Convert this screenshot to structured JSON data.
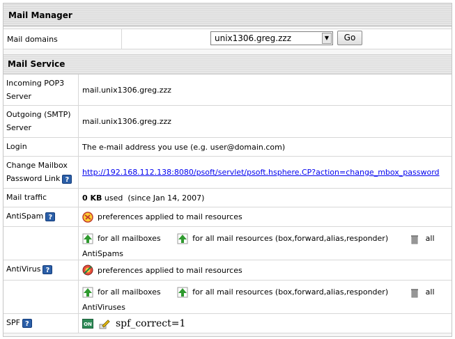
{
  "header": {
    "title": "Mail Manager"
  },
  "domains": {
    "label": "Mail domains",
    "selected": "unix1306.greg.zzz",
    "go_label": "Go"
  },
  "section": {
    "title": "Mail Service"
  },
  "rows": {
    "pop3": {
      "label": "Incoming POP3 Server",
      "value": "mail.unix1306.greg.zzz"
    },
    "smtp": {
      "label": "Outgoing (SMTP) Server",
      "value": "mail.unix1306.greg.zzz"
    },
    "login": {
      "label": "Login",
      "value": "The e-mail address you use (e.g. user@domain.com)"
    },
    "change_pw": {
      "label": "Change Mailbox Password Link",
      "url": "http://192.168.112.138:8080/psoft/servlet/psoft.hsphere.CP?action=change_mbox_password"
    },
    "traffic": {
      "label": "Mail traffic",
      "amount": "0 KB",
      "unit_text": "used",
      "since": "(since Jan 14, 2007)"
    },
    "antispam": {
      "label": "AntiSpam",
      "pref_text": "preferences applied to mail resources",
      "all_mailboxes": "for all mailboxes",
      "all_resources": "for all mail resources (box,forward,alias,responder)",
      "all_prefix": "all",
      "all_suffix": "AntiSpams"
    },
    "antivirus": {
      "label": "AntiVirus",
      "pref_text": "preferences applied to mail resources",
      "all_mailboxes": "for all mailboxes",
      "all_resources": "for all mail resources (box,forward,alias,responder)",
      "all_prefix": "all",
      "all_suffix": "AntiViruses"
    },
    "spf": {
      "label": "SPF",
      "on_badge": "ON",
      "value": "spf_correct=1"
    }
  },
  "help_glyph": "?",
  "colors": {
    "link": "#0000ee",
    "help_bg": "#2b5fa8",
    "add_green": "#2f9a2f"
  },
  "icons": [
    "help-icon",
    "antispam-icon",
    "antivirus-icon",
    "add-arrow-icon",
    "trash-icon",
    "on-toggle-icon",
    "edit-pencil-icon"
  ]
}
